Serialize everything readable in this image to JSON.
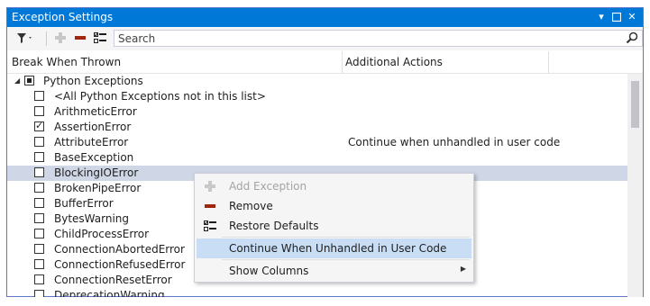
{
  "window": {
    "title": "Exception Settings"
  },
  "toolbar": {
    "search_placeholder": "Search"
  },
  "columns": {
    "break_when_thrown": "Break When Thrown",
    "additional_actions": "Additional Actions"
  },
  "rows": [
    {
      "label": "Python Exceptions",
      "state": "partial",
      "action": ""
    },
    {
      "label": "<All Python Exceptions not in this list>",
      "state": "unchecked",
      "action": ""
    },
    {
      "label": "ArithmeticError",
      "state": "unchecked",
      "action": ""
    },
    {
      "label": "AssertionError",
      "state": "checked",
      "action": ""
    },
    {
      "label": "AttributeError",
      "state": "unchecked",
      "action": "Continue when unhandled in user code"
    },
    {
      "label": "BaseException",
      "state": "unchecked",
      "action": ""
    },
    {
      "label": "BlockingIOError",
      "state": "unchecked",
      "action": ""
    },
    {
      "label": "BrokenPipeError",
      "state": "unchecked",
      "action": ""
    },
    {
      "label": "BufferError",
      "state": "unchecked",
      "action": ""
    },
    {
      "label": "BytesWarning",
      "state": "unchecked",
      "action": ""
    },
    {
      "label": "ChildProcessError",
      "state": "unchecked",
      "action": ""
    },
    {
      "label": "ConnectionAbortedError",
      "state": "unchecked",
      "action": ""
    },
    {
      "label": "ConnectionRefusedError",
      "state": "unchecked",
      "action": ""
    },
    {
      "label": "ConnectionResetError",
      "state": "unchecked",
      "action": ""
    },
    {
      "label": "DeprecationWarning",
      "state": "unchecked",
      "action": ""
    }
  ],
  "context_menu": {
    "add_exception": "Add Exception",
    "remove": "Remove",
    "restore_defaults": "Restore Defaults",
    "continue_unhandled": "Continue When Unhandled in User Code",
    "show_columns": "Show Columns"
  },
  "colors": {
    "title_bar": "#0078d7",
    "selected_row": "#cfd6e5",
    "menu_highlight": "#c9def5",
    "remove_red": "#c0392b"
  }
}
